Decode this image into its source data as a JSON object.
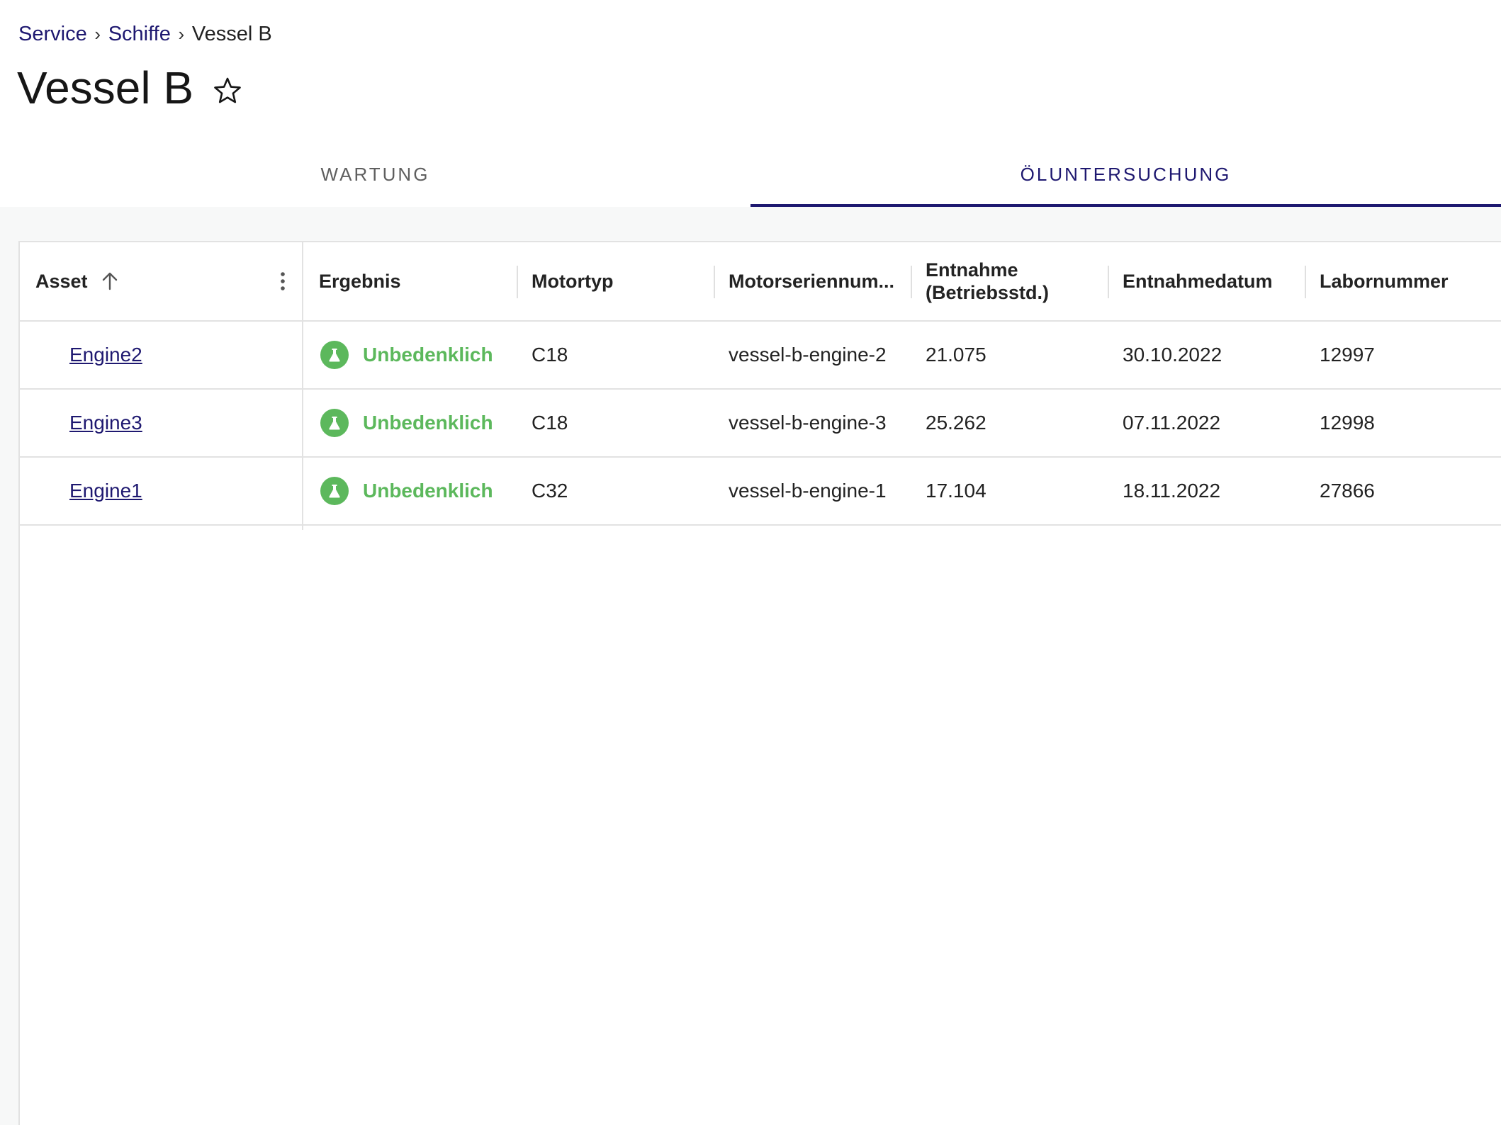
{
  "breadcrumb": {
    "items": [
      "Service",
      "Schiffe"
    ],
    "current": "Vessel B",
    "separator": "›"
  },
  "page": {
    "title": "Vessel B",
    "favorite_icon": "star-outline-icon"
  },
  "tabs": [
    {
      "label": "WARTUNG",
      "active": false
    },
    {
      "label": "ÖLUNTERSUCHUNG",
      "active": true
    }
  ],
  "table": {
    "columns": {
      "asset": "Asset",
      "ergebnis": "Ergebnis",
      "motortyp": "Motortyp",
      "motorseriennummer": "Motorseriennum...",
      "entnahme": "Entnahme (Betriebsstd.)",
      "entnahmedatum": "Entnahmedatum",
      "labornummer": "Labornummer"
    },
    "sort": {
      "column": "asset",
      "direction": "ascending",
      "icon": "arrow-up-icon"
    },
    "column_menu_icon": "more-vert-icon",
    "rows": [
      {
        "asset": "Engine2",
        "ergebnis": "Unbedenklich",
        "motortyp": "C18",
        "motorseriennummer": "vessel-b-engine-2",
        "entnahme": "21.075",
        "entnahmedatum": "30.10.2022",
        "labornummer": "12997"
      },
      {
        "asset": "Engine3",
        "ergebnis": "Unbedenklich",
        "motortyp": "C18",
        "motorseriennummer": "vessel-b-engine-3",
        "entnahme": "25.262",
        "entnahmedatum": "07.11.2022",
        "labornummer": "12998"
      },
      {
        "asset": "Engine1",
        "ergebnis": "Unbedenklich",
        "motortyp": "C32",
        "motorseriennummer": "vessel-b-engine-1",
        "entnahme": "17.104",
        "entnahmedatum": "18.11.2022",
        "labornummer": "27866"
      }
    ],
    "result_icon": "flask-icon"
  },
  "colors": {
    "primary": "#1e1870",
    "success": "#5cb85c",
    "background": "#f7f8f8",
    "border": "#e2e2e2"
  }
}
